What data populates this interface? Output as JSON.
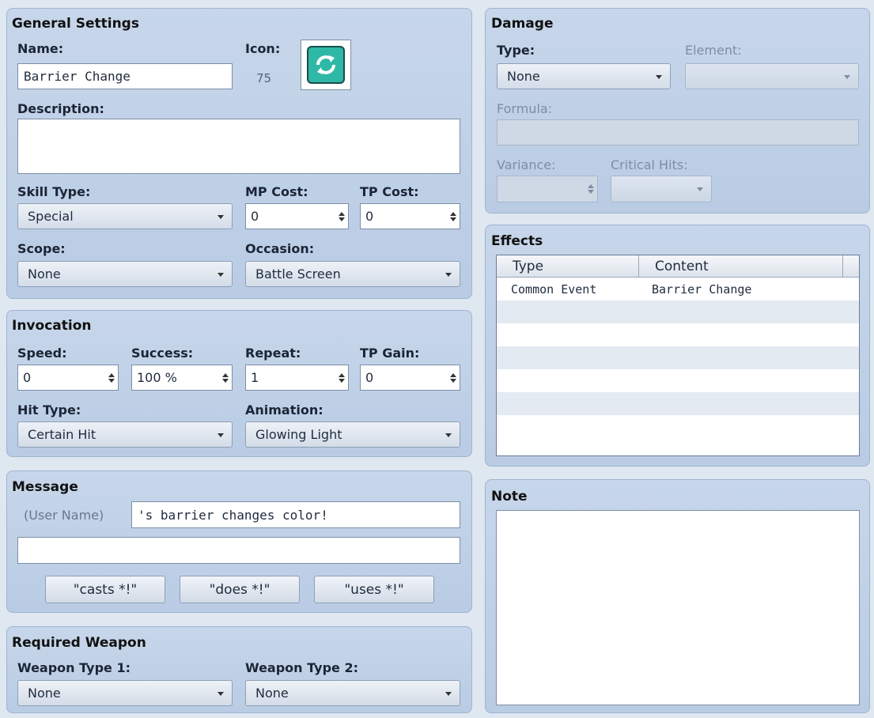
{
  "general": {
    "title": "General Settings",
    "name_label": "Name:",
    "name_value": "Barrier Change",
    "icon_label": "Icon:",
    "icon_index": "75",
    "description_label": "Description:",
    "description_value": "",
    "skill_type_label": "Skill Type:",
    "skill_type_value": "Special",
    "mp_cost_label": "MP Cost:",
    "mp_cost_value": "0",
    "tp_cost_label": "TP Cost:",
    "tp_cost_value": "0",
    "scope_label": "Scope:",
    "scope_value": "None",
    "occasion_label": "Occasion:",
    "occasion_value": "Battle Screen"
  },
  "invocation": {
    "title": "Invocation",
    "speed_label": "Speed:",
    "speed_value": "0",
    "success_label": "Success:",
    "success_value": "100 %",
    "repeat_label": "Repeat:",
    "repeat_value": "1",
    "tp_gain_label": "TP Gain:",
    "tp_gain_value": "0",
    "hit_type_label": "Hit Type:",
    "hit_type_value": "Certain Hit",
    "animation_label": "Animation:",
    "animation_value": "Glowing Light"
  },
  "message": {
    "title": "Message",
    "user_name_label": "(User Name)",
    "line1_value": "'s barrier changes color!",
    "line2_value": "",
    "btn_casts": "\"casts *!\"",
    "btn_does": "\"does *!\"",
    "btn_uses": "\"uses *!\""
  },
  "weapon": {
    "title": "Required Weapon",
    "type1_label": "Weapon Type 1:",
    "type1_value": "None",
    "type2_label": "Weapon Type 2:",
    "type2_value": "None"
  },
  "damage": {
    "title": "Damage",
    "type_label": "Type:",
    "type_value": "None",
    "element_label": "Element:",
    "element_value": "",
    "formula_label": "Formula:",
    "formula_value": "",
    "variance_label": "Variance:",
    "variance_value": "",
    "critical_label": "Critical Hits:",
    "critical_value": ""
  },
  "effects": {
    "title": "Effects",
    "col_type": "Type",
    "col_content": "Content",
    "rows": [
      {
        "type": "Common Event",
        "content": "Barrier Change"
      },
      {
        "type": "",
        "content": ""
      },
      {
        "type": "",
        "content": ""
      },
      {
        "type": "",
        "content": ""
      },
      {
        "type": "",
        "content": ""
      },
      {
        "type": "",
        "content": ""
      },
      {
        "type": "",
        "content": ""
      }
    ]
  },
  "note": {
    "title": "Note",
    "value": ""
  },
  "icon": {
    "name": "refresh-arrows-icon",
    "color": "#2fb8a6"
  }
}
